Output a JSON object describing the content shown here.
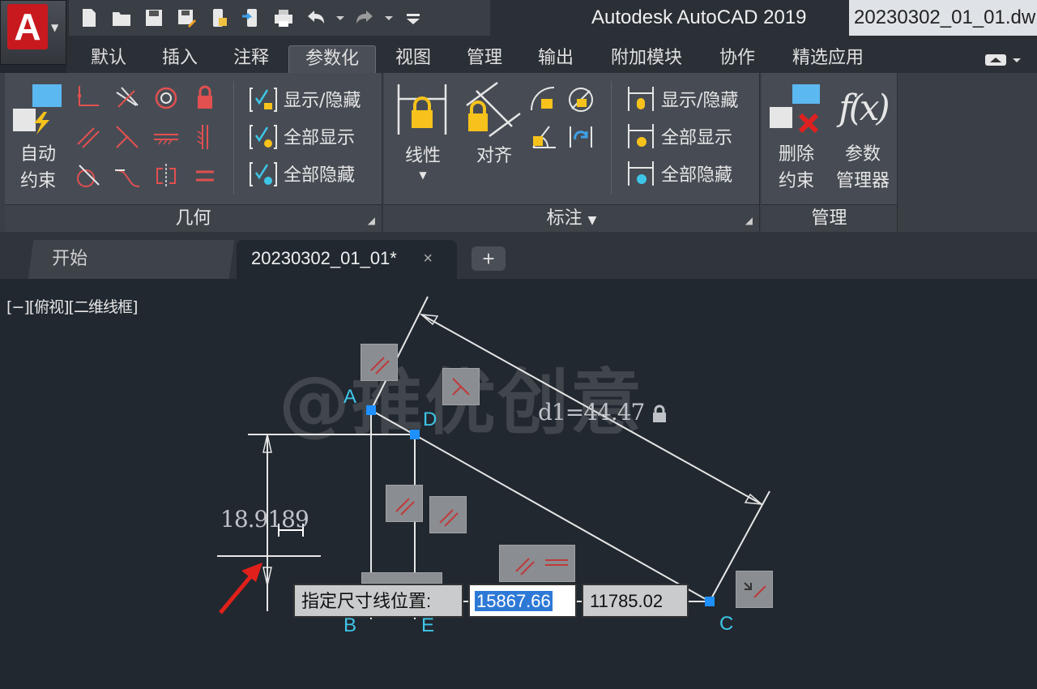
{
  "window": {
    "app_title": "Autodesk AutoCAD 2019",
    "file_title": "20230302_01_01.dw"
  },
  "app_button": {
    "letter": "A",
    "color": "#c8191f"
  },
  "quick_access": [
    "new-icon",
    "open-icon",
    "save-icon",
    "save-as-icon",
    "open-web-icon",
    "save-web-icon",
    "plot-icon",
    "undo-icon",
    "redo-icon",
    "customize-icon"
  ],
  "ribbon_tabs": [
    "默认",
    "插入",
    "注释",
    "参数化",
    "视图",
    "管理",
    "输出",
    "附加模块",
    "协作",
    "精选应用"
  ],
  "active_tab": "参数化",
  "panels": {
    "geometry": {
      "title": "几何",
      "auto_constrain": [
        "自动",
        "约束"
      ],
      "show_hide": "显示/隐藏",
      "show_all": "全部显示",
      "hide_all": "全部隐藏"
    },
    "dimension": {
      "title": "标注",
      "linear": "线性",
      "aligned": "对齐",
      "show_hide": "显示/隐藏",
      "show_all": "全部显示",
      "hide_all": "全部隐藏"
    },
    "manage": {
      "title": "管理",
      "delete_constraint": [
        "删除",
        "约束"
      ],
      "param_manager": [
        "参数",
        "管理器"
      ],
      "fx": "f(x)"
    }
  },
  "doc_tabs": {
    "start": "开始",
    "file": "20230302_01_01*",
    "close": "×",
    "add": "+"
  },
  "viewport": {
    "label": "[−][俯视][二维线框]",
    "watermark": "@推优创意"
  },
  "drawing": {
    "points": {
      "A": "A",
      "B": "B",
      "C": "C",
      "D": "D",
      "E": "E"
    },
    "aligned_dim": "d1=44.47",
    "vertical_dim": "18.9189",
    "line_color": "#e6e6e6",
    "grip_color": "#1e90ff",
    "arrow_color": "#e0201a"
  },
  "dynamic_input": {
    "prompt": "指定尺寸线位置:",
    "value1": "15867.66",
    "value2": "11785.02"
  }
}
